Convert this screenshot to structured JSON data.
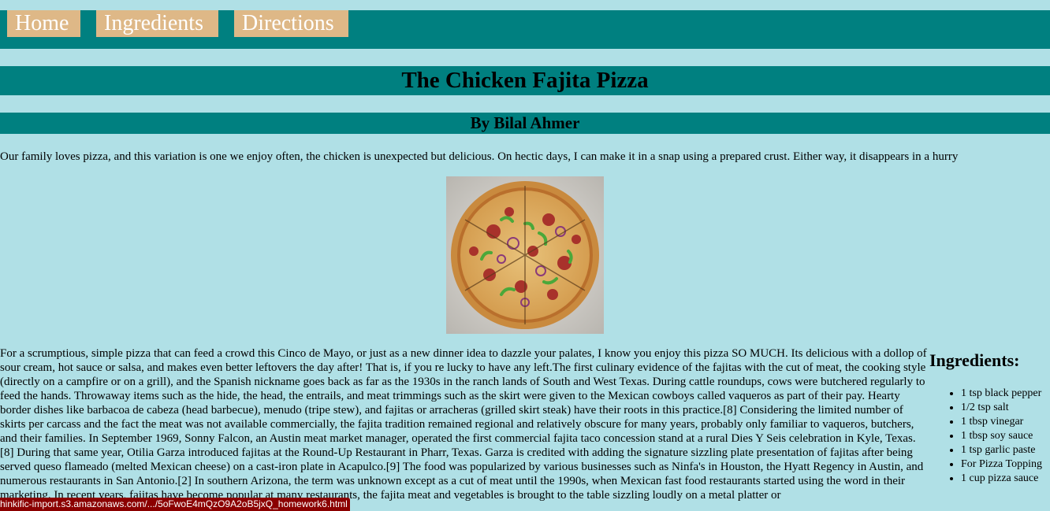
{
  "nav": {
    "home": "Home",
    "ingredients": "Ingredients",
    "directions": "Directions"
  },
  "header": {
    "title": "The Chicken Fajita Pizza",
    "author": "By Bilal Ahmer"
  },
  "intro": "Our family loves pizza, and this variation is one we enjoy often, the chicken is unexpected but delicious. On hectic days, I can make it in a snap using a prepared crust. Either way, it disappears in a hurry",
  "story": "For a scrumptious, simple pizza that can feed a crowd this Cinco de Mayo, or just as a new dinner idea to dazzle your palates, I know you enjoy this pizza SO MUCH. Its delicious with a dollop of sour cream, hot sauce or salsa, and makes even better leftovers the day after! That is, if you re lucky to have any left.The first culinary evidence of the fajitas with the cut of meat, the cooking style (directly on a campfire or on a grill), and the Spanish nickname goes back as far as the 1930s in the ranch lands of South and West Texas. During cattle roundups, cows were butchered regularly to feed the hands. Throwaway items such as the hide, the head, the entrails, and meat trimmings such as the skirt were given to the Mexican cowboys called vaqueros as part of their pay. Hearty border dishes like barbacoa de cabeza (head barbecue), menudo (tripe stew), and fajitas or arracheras (grilled skirt steak) have their roots in this practice.[8] Considering the limited number of skirts per carcass and the fact the meat was not available commercially, the fajita tradition remained regional and relatively obscure for many years, probably only familiar to vaqueros, butchers, and their families. In September 1969, Sonny Falcon, an Austin meat market manager, operated the first commercial fajita taco concession stand at a rural Dies Y Seis celebration in Kyle, Texas.[8] During that same year, Otilia Garza introduced fajitas at the Round-Up Restaurant in Pharr, Texas. Garza is credited with adding the signature sizzling plate presentation of fajitas after being served queso flameado (melted Mexican cheese) on a cast-iron plate in Acapulco.[9] The food was popularized by various businesses such as Ninfa's in Houston, the Hyatt Regency in Austin, and numerous restaurants in San Antonio.[2] In southern Arizona, the term was unknown except as a cut of meat until the 1990s, when Mexican fast food restaurants started using the word in their marketing. In recent years, fajitas have become popular at many restaurants, the fajita meat and vegetables is brought to the table sizzling loudly on a metal platter or",
  "sidebar": {
    "heading": "Ingredients:",
    "items": [
      "1 tsp black pepper",
      "1/2 tsp salt",
      "1 tbsp vinegar",
      "1 tbsp soy sauce",
      "1 tsp garlic paste",
      "For Pizza Topping",
      "1 cup pizza sauce"
    ]
  },
  "status_url": "hinkific-import.s3.amazonaws.com/.../5oFwoE4mQzO9A2oB5jxQ_homework6.html",
  "colors": {
    "page_bg": "#b0e0e6",
    "bar_bg": "#008080",
    "nav_button_bg": "#deb887",
    "status_bg": "#8b0000"
  }
}
